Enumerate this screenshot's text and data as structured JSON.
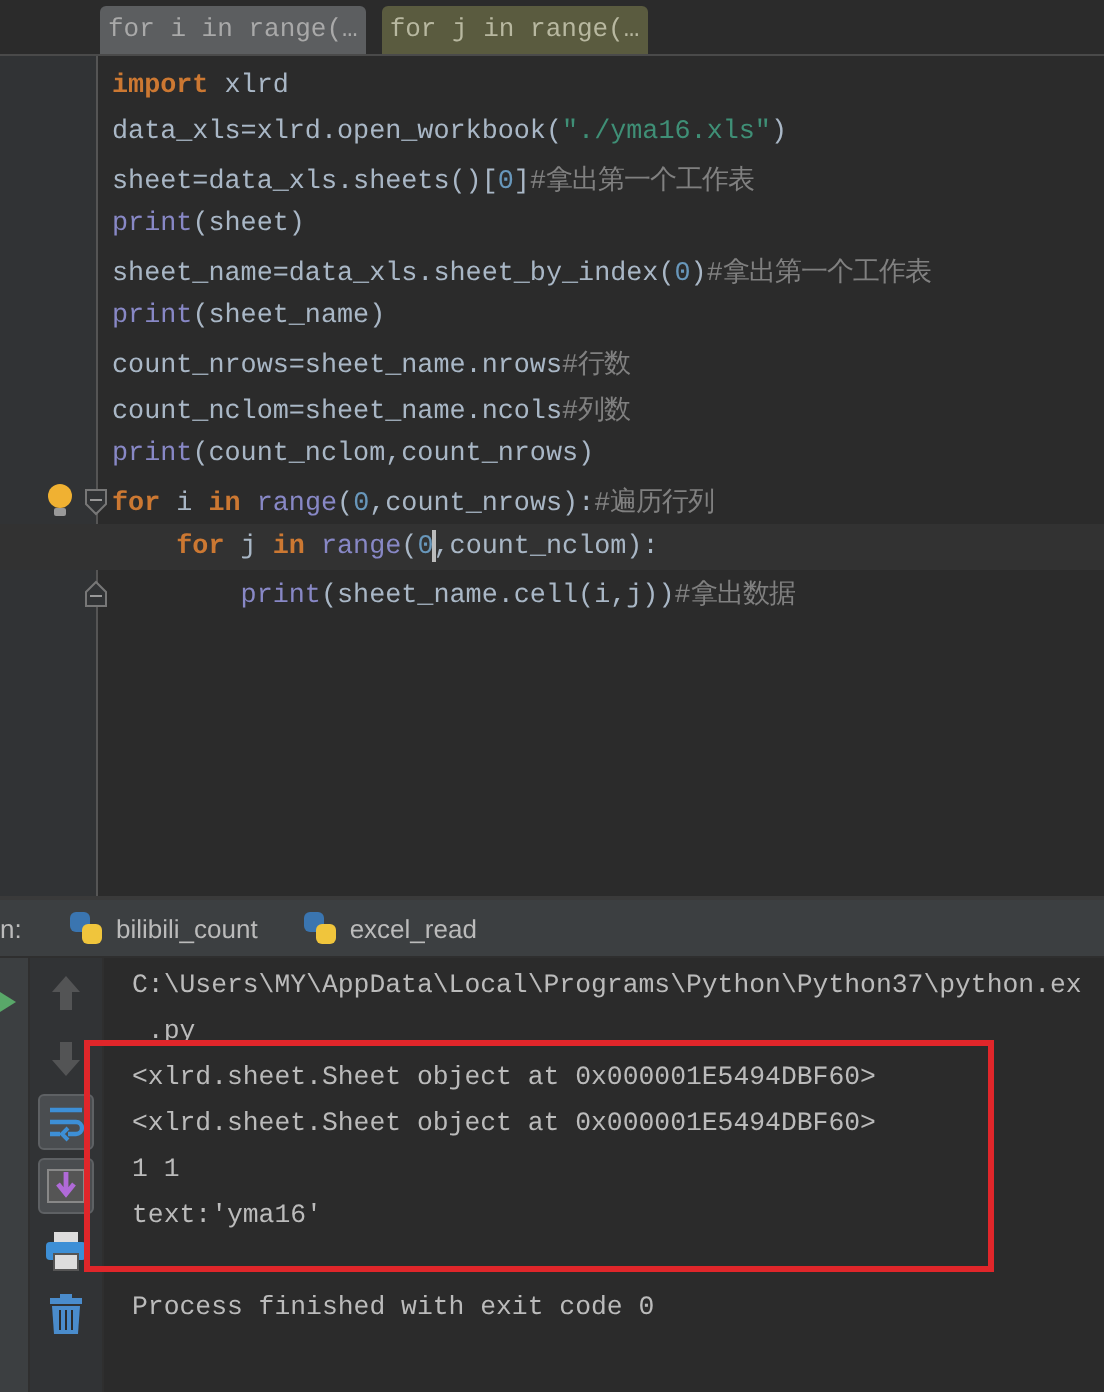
{
  "breadcrumbs": [
    {
      "label": "for i in range(…",
      "selected": false
    },
    {
      "label": "for j in range(…",
      "selected": true
    }
  ],
  "editor": {
    "lines": [
      {
        "current": false,
        "fold_open": false,
        "fold_close": false,
        "hint": false,
        "tokens": [
          {
            "kind": "keyword",
            "text": "import"
          },
          {
            "kind": "plain",
            "text": " xlrd"
          }
        ]
      },
      {
        "current": false,
        "fold_open": false,
        "fold_close": false,
        "hint": false,
        "tokens": [
          {
            "kind": "plain",
            "text": "data_xls=xlrd.open_workbook("
          },
          {
            "kind": "string",
            "text": "\"./yma16.xls\""
          },
          {
            "kind": "plain",
            "text": ")"
          }
        ]
      },
      {
        "current": false,
        "fold_open": false,
        "fold_close": false,
        "hint": false,
        "tokens": [
          {
            "kind": "plain",
            "text": "sheet=data_xls.sheets()["
          },
          {
            "kind": "number",
            "text": "0"
          },
          {
            "kind": "plain",
            "text": "]"
          },
          {
            "kind": "comment",
            "text": "#拿出第一个工作表"
          }
        ]
      },
      {
        "current": false,
        "fold_open": false,
        "fold_close": false,
        "hint": false,
        "tokens": [
          {
            "kind": "builtin",
            "text": "print"
          },
          {
            "kind": "plain",
            "text": "(sheet)"
          }
        ]
      },
      {
        "current": false,
        "fold_open": false,
        "fold_close": false,
        "hint": false,
        "tokens": [
          {
            "kind": "plain",
            "text": "sheet_name=data_xls.sheet_by_index("
          },
          {
            "kind": "number",
            "text": "0"
          },
          {
            "kind": "plain",
            "text": ")"
          },
          {
            "kind": "comment",
            "text": "#拿出第一个工作表"
          }
        ]
      },
      {
        "current": false,
        "fold_open": false,
        "fold_close": false,
        "hint": false,
        "tokens": [
          {
            "kind": "builtin",
            "text": "print"
          },
          {
            "kind": "plain",
            "text": "(sheet_name)"
          }
        ]
      },
      {
        "current": false,
        "fold_open": false,
        "fold_close": false,
        "hint": false,
        "tokens": [
          {
            "kind": "plain",
            "text": "count_nrows=sheet_name.nrows"
          },
          {
            "kind": "comment",
            "text": "#行数"
          }
        ]
      },
      {
        "current": false,
        "fold_open": false,
        "fold_close": false,
        "hint": false,
        "tokens": [
          {
            "kind": "plain",
            "text": "count_nclom=sheet_name.ncols"
          },
          {
            "kind": "comment",
            "text": "#列数"
          }
        ]
      },
      {
        "current": false,
        "fold_open": false,
        "fold_close": false,
        "hint": false,
        "tokens": [
          {
            "kind": "builtin",
            "text": "print"
          },
          {
            "kind": "plain",
            "text": "(count_nclom,count_nrows)"
          }
        ]
      },
      {
        "current": false,
        "fold_open": true,
        "fold_close": false,
        "hint": true,
        "tokens": [
          {
            "kind": "keyword",
            "text": "for"
          },
          {
            "kind": "plain",
            "text": " i "
          },
          {
            "kind": "keyword",
            "text": "in"
          },
          {
            "kind": "builtin",
            "text": " range"
          },
          {
            "kind": "plain",
            "text": "("
          },
          {
            "kind": "number",
            "text": "0"
          },
          {
            "kind": "plain",
            "text": ",count_nrows):"
          },
          {
            "kind": "comment",
            "text": "#遍历行列"
          }
        ]
      },
      {
        "current": true,
        "fold_open": false,
        "fold_close": false,
        "hint": false,
        "tokens": [
          {
            "kind": "keyword",
            "text": "    for"
          },
          {
            "kind": "plain",
            "text": " j "
          },
          {
            "kind": "keyword",
            "text": "in"
          },
          {
            "kind": "builtin",
            "text": " range"
          },
          {
            "kind": "plain",
            "text": "("
          },
          {
            "kind": "number",
            "text": "0"
          },
          {
            "kind": "caret"
          },
          {
            "kind": "plain",
            "text": ",count_nclom):"
          }
        ]
      },
      {
        "current": false,
        "fold_open": false,
        "fold_close": true,
        "hint": false,
        "tokens": [
          {
            "kind": "builtin",
            "text": "        print"
          },
          {
            "kind": "plain",
            "text": "(sheet_name.cell(i,j))"
          },
          {
            "kind": "comment",
            "text": "#拿出数据"
          }
        ]
      }
    ]
  },
  "run_panel": {
    "label": "n:",
    "tabs": [
      {
        "label": "bilibili_count"
      },
      {
        "label": "excel_read"
      }
    ],
    "tools": [
      {
        "kind": "up",
        "on": false,
        "disabled": true
      },
      {
        "kind": "down",
        "on": false,
        "disabled": true
      },
      {
        "kind": "wrap",
        "on": true,
        "disabled": false
      },
      {
        "kind": "scroll-end",
        "on": true,
        "disabled": false
      },
      {
        "kind": "print",
        "on": false,
        "disabled": false
      },
      {
        "kind": "trash",
        "on": false,
        "disabled": false
      }
    ],
    "console": [
      {
        "kind": "output",
        "text": "C:\\Users\\MY\\AppData\\Local\\Programs\\Python\\Python37\\python.ex"
      },
      {
        "kind": "output",
        "text": " .py"
      },
      {
        "kind": "output",
        "text": "<xlrd.sheet.Sheet object at 0x000001E5494DBF60>"
      },
      {
        "kind": "output",
        "text": "<xlrd.sheet.Sheet object at 0x000001E5494DBF60>"
      },
      {
        "kind": "output",
        "text": "1 1"
      },
      {
        "kind": "output",
        "text": "text:'yma16'"
      },
      {
        "kind": "exit",
        "text": "Process finished with exit code 0"
      }
    ],
    "annotation": {
      "kind": "red-box"
    }
  }
}
